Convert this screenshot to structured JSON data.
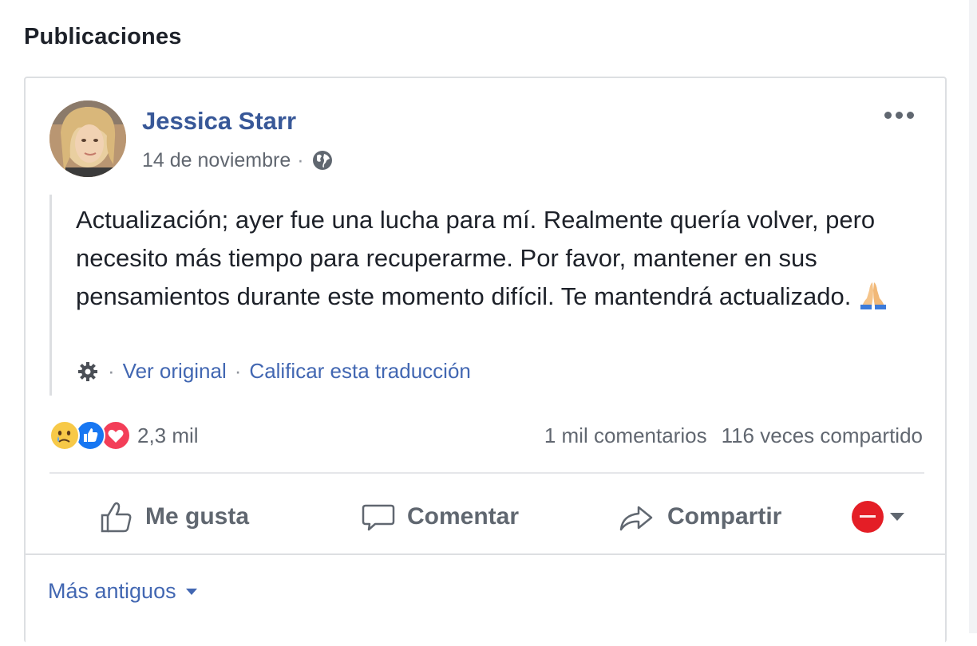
{
  "section": {
    "title": "Publicaciones"
  },
  "post": {
    "author": "Jessica Starr",
    "date": "14 de noviembre",
    "meta_separator": "·",
    "text": "Actualización; ayer fue una lucha para mí. Realmente quería volver, pero necesito más tiempo para recuperarme. Por favor, mantener en sus pensamientos durante este momento difícil. Te mantendrá actualizado.",
    "icons": {
      "visibility": "globe-icon",
      "menu": "more-options-icon",
      "emoji": "folded-hands-emoji"
    }
  },
  "translation": {
    "dot": "·",
    "view_original": "Ver original",
    "rate_translation": "Calificar esta traducción"
  },
  "stats": {
    "reactions_count": "2,3 mil",
    "comments": "1 mil comentarios",
    "shares": "116 veces compartido",
    "reaction_types": [
      "sad",
      "like",
      "love"
    ]
  },
  "actions": {
    "like": "Me gusta",
    "comment": "Comentar",
    "share": "Compartir"
  },
  "footer": {
    "older": "Más antiguos"
  },
  "colors": {
    "link": "#4267b2",
    "author": "#385898",
    "like_blue": "#1877f2",
    "love_red": "#f33e58",
    "sad_yellow": "#f7c948",
    "page_avatar_red": "#e41e26"
  }
}
